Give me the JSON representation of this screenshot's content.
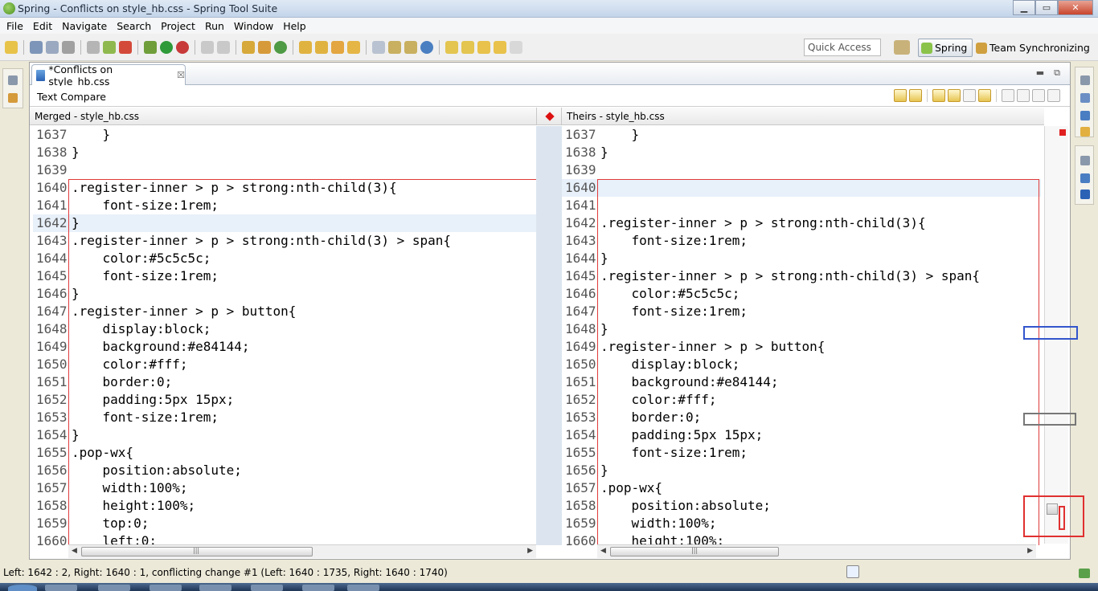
{
  "window": {
    "title": "Spring - Conflicts on style_hb.css - Spring Tool Suite",
    "controls": {
      "minimize": "▁",
      "maximize": "▭",
      "close": "✕"
    }
  },
  "menu": [
    "File",
    "Edit",
    "Navigate",
    "Search",
    "Project",
    "Run",
    "Window",
    "Help"
  ],
  "toolbar": {
    "quick_access_placeholder": "Quick Access",
    "perspectives": [
      {
        "label": "Spring",
        "active": true
      },
      {
        "label": "Team Synchronizing",
        "active": false
      }
    ]
  },
  "editor": {
    "tab": {
      "label": "*Conflicts on style_hb.css",
      "close_glyph": "☒"
    },
    "view_buttons": {
      "minimize": "▬",
      "maximize": "⧉"
    },
    "compare_title": "Text Compare",
    "left_header": "Merged - style_hb.css",
    "right_header": "Theirs - style_hb.css",
    "left_lines": [
      {
        "n": "1637",
        "code": "    }"
      },
      {
        "n": "1638",
        "code": "}"
      },
      {
        "n": "1639",
        "code": ""
      },
      {
        "n": "1640",
        "code": ".register-inner > p > strong:nth-child(3){"
      },
      {
        "n": "1641",
        "code": "    font-size:1rem;"
      },
      {
        "n": "1642",
        "code": "}",
        "hl": true
      },
      {
        "n": "1643",
        "code": ".register-inner > p > strong:nth-child(3) > span{"
      },
      {
        "n": "1644",
        "code": "    color:#5c5c5c;"
      },
      {
        "n": "1645",
        "code": "    font-size:1rem;"
      },
      {
        "n": "1646",
        "code": "}"
      },
      {
        "n": "1647",
        "code": ".register-inner > p > button{"
      },
      {
        "n": "1648",
        "code": "    display:block;"
      },
      {
        "n": "1649",
        "code": "    background:#e84144;"
      },
      {
        "n": "1650",
        "code": "    color:#fff;"
      },
      {
        "n": "1651",
        "code": "    border:0;"
      },
      {
        "n": "1652",
        "code": "    padding:5px 15px;"
      },
      {
        "n": "1653",
        "code": "    font-size:1rem;"
      },
      {
        "n": "1654",
        "code": "}"
      },
      {
        "n": "1655",
        "code": ".pop-wx{"
      },
      {
        "n": "1656",
        "code": "    position:absolute;"
      },
      {
        "n": "1657",
        "code": "    width:100%;"
      },
      {
        "n": "1658",
        "code": "    height:100%;"
      },
      {
        "n": "1659",
        "code": "    top:0;"
      },
      {
        "n": "1660",
        "code": "    left:0;"
      }
    ],
    "right_lines": [
      {
        "n": "1637",
        "code": "    }"
      },
      {
        "n": "1638",
        "code": "}"
      },
      {
        "n": "1639",
        "code": ""
      },
      {
        "n": "1640",
        "code": "",
        "hl": true
      },
      {
        "n": "1641",
        "code": ""
      },
      {
        "n": "1642",
        "code": ".register-inner > p > strong:nth-child(3){"
      },
      {
        "n": "1643",
        "code": "    font-size:1rem;"
      },
      {
        "n": "1644",
        "code": "}"
      },
      {
        "n": "1645",
        "code": ".register-inner > p > strong:nth-child(3) > span{"
      },
      {
        "n": "1646",
        "code": "    color:#5c5c5c;"
      },
      {
        "n": "1647",
        "code": "    font-size:1rem;"
      },
      {
        "n": "1648",
        "code": "}"
      },
      {
        "n": "1649",
        "code": ".register-inner > p > button{"
      },
      {
        "n": "1650",
        "code": "    display:block;"
      },
      {
        "n": "1651",
        "code": "    background:#e84144;"
      },
      {
        "n": "1652",
        "code": "    color:#fff;"
      },
      {
        "n": "1653",
        "code": "    border:0;"
      },
      {
        "n": "1654",
        "code": "    padding:5px 15px;"
      },
      {
        "n": "1655",
        "code": "    font-size:1rem;"
      },
      {
        "n": "1656",
        "code": "}"
      },
      {
        "n": "1657",
        "code": ".pop-wx{"
      },
      {
        "n": "1658",
        "code": "    position:absolute;"
      },
      {
        "n": "1659",
        "code": "    width:100%;"
      },
      {
        "n": "1660",
        "code": "    height:100%;"
      }
    ]
  },
  "status": {
    "text": "Left: 1642 : 2, Right: 1640 : 1, conflicting change #1 (Left: 1640 : 1735, Right: 1640 : 1740)"
  },
  "colors": {
    "conflict": "#e03a3a",
    "highlight": "#e8f0fa",
    "gutter": "#dce5ef"
  }
}
